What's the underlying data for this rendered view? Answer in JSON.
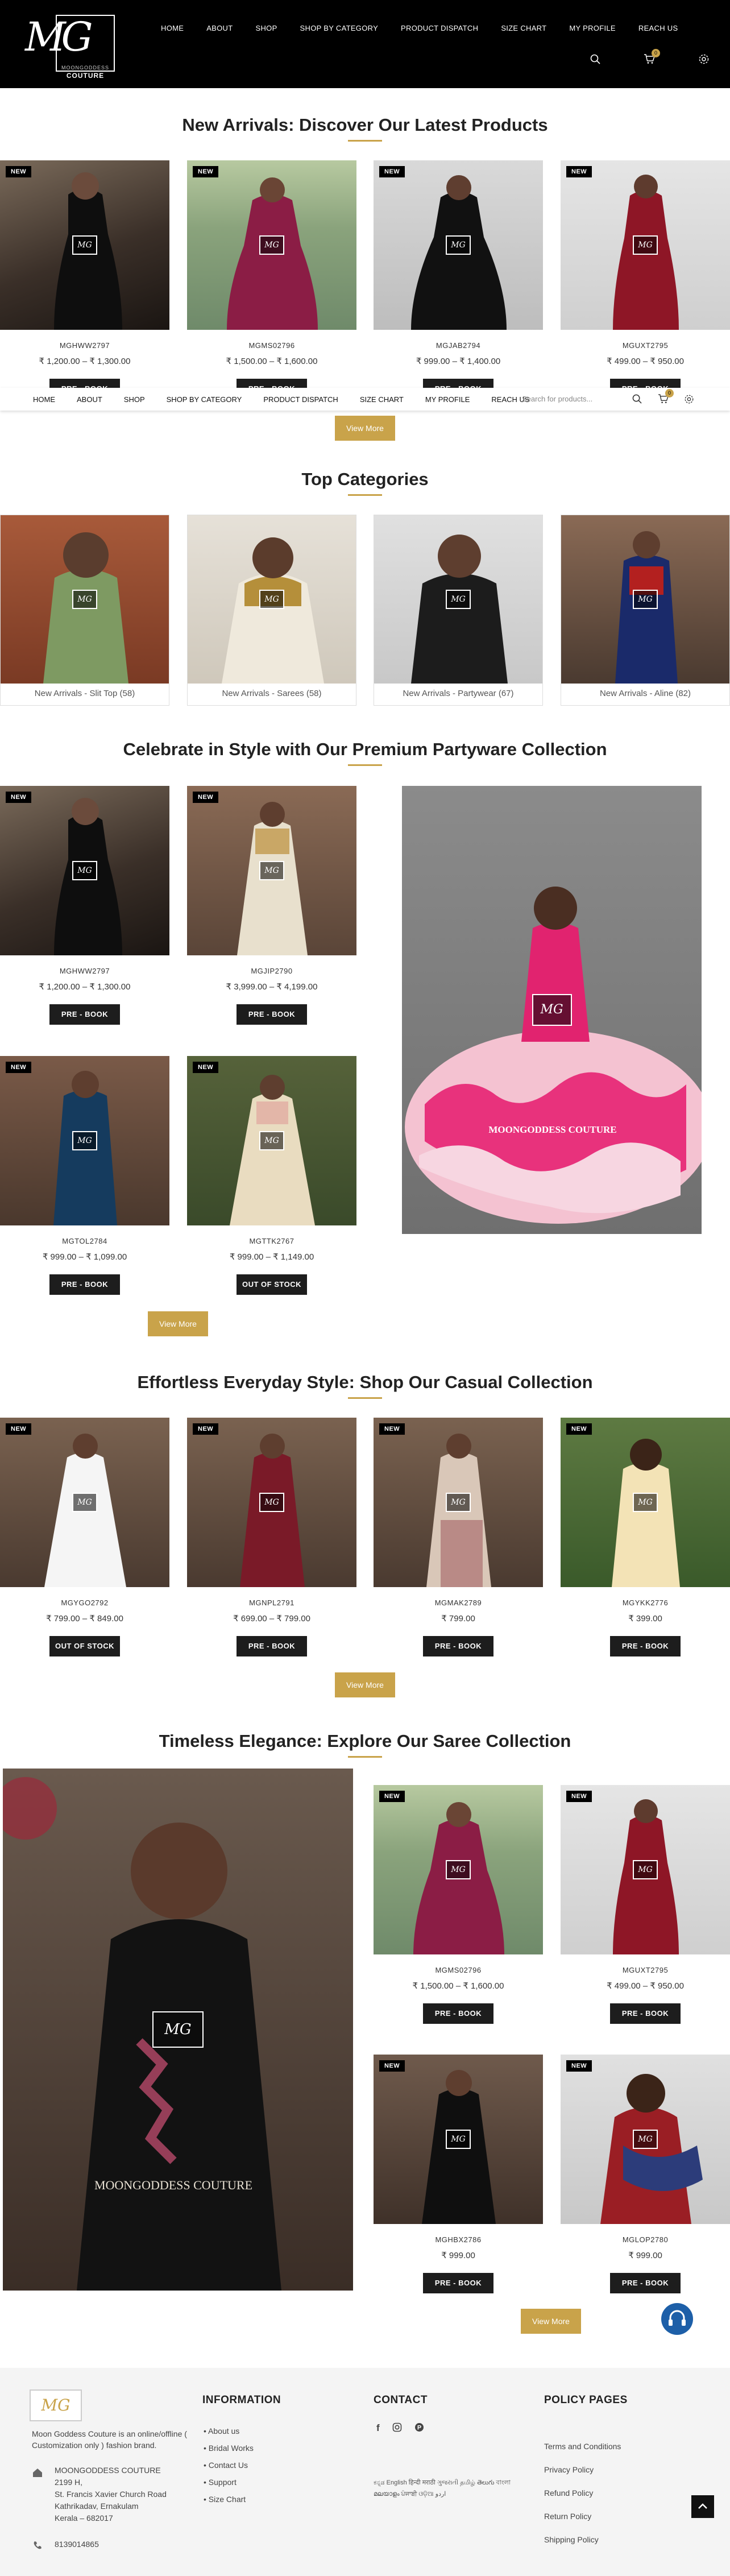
{
  "header": {
    "logo_brand_top": "MOONGODDESS",
    "logo_brand_bottom": "COUTURE",
    "logo_initials": "MG",
    "nav": [
      "HOME",
      "ABOUT",
      "SHOP",
      "SHOP BY CATEGORY",
      "PRODUCT DISPATCH",
      "SIZE CHART",
      "MY PROFILE",
      "REACH US"
    ],
    "cart_count": "0"
  },
  "sticky": {
    "nav": [
      "HOME",
      "ABOUT",
      "SHOP",
      "SHOP BY CATEGORY",
      "PRODUCT DISPATCH",
      "SIZE CHART",
      "MY PROFILE",
      "REACH US"
    ],
    "search_placeholder": "Search for products...",
    "cart_count": "0"
  },
  "new_arrivals": {
    "title": "New Arrivals: Discover Our Latest Products",
    "view_more": "View More",
    "products": [
      {
        "sku": "MGHWW2797",
        "price": "₹ 1,200.00 – ₹ 1,300.00",
        "badge": "NEW",
        "button": "PRE - BOOK"
      },
      {
        "sku": "MGMS02796",
        "price": "₹ 1,500.00 – ₹ 1,600.00",
        "badge": "NEW",
        "button": "PRE - BOOK"
      },
      {
        "sku": "MGJAB2794",
        "price": "₹ 999.00 – ₹ 1,400.00",
        "badge": "NEW",
        "button": "PRE - BOOK"
      },
      {
        "sku": "MGUXT2795",
        "price": "₹ 499.00 – ₹ 950.00",
        "badge": "NEW",
        "button": "PRE - BOOK"
      }
    ]
  },
  "top_categories": {
    "title": "Top Categories",
    "items": [
      {
        "label": "New Arrivals - Slit Top (58)"
      },
      {
        "label": "New Arrivals - Sarees (58)"
      },
      {
        "label": "New Arrivals - Partywear (67)"
      },
      {
        "label": "New Arrivals - Aline (82)"
      }
    ]
  },
  "partyware": {
    "title": "Celebrate in Style with Our Premium Partyware Collection",
    "view_more": "View More",
    "feature_caption": "MOONGODDESS COUTURE",
    "products": [
      {
        "sku": "MGHWW2797",
        "price": "₹ 1,200.00 – ₹ 1,300.00",
        "badge": "NEW",
        "button": "PRE - BOOK"
      },
      {
        "sku": "MGJIP2790",
        "price": "₹ 3,999.00 – ₹ 4,199.00",
        "badge": "NEW",
        "button": "PRE - BOOK"
      },
      {
        "sku": "MGTOL2784",
        "price": "₹ 999.00 – ₹ 1,099.00",
        "badge": "NEW",
        "button": "PRE - BOOK"
      },
      {
        "sku": "MGTTK2767",
        "price": "₹ 999.00 – ₹ 1,149.00",
        "badge": "NEW",
        "button": "OUT OF STOCK"
      }
    ]
  },
  "casual": {
    "title": "Effortless Everyday Style: Shop Our Casual Collection",
    "view_more": "View More",
    "products": [
      {
        "sku": "MGYGO2792",
        "price": "₹ 799.00 – ₹ 849.00",
        "badge": "NEW",
        "button": "OUT OF STOCK"
      },
      {
        "sku": "MGNPL2791",
        "price": "₹ 699.00 – ₹ 799.00",
        "badge": "NEW",
        "button": "PRE - BOOK"
      },
      {
        "sku": "MGMAK2789",
        "price": "₹ 799.00",
        "badge": "NEW",
        "button": "PRE - BOOK"
      },
      {
        "sku": "MGYKK2776",
        "price": "₹ 399.00",
        "badge": "NEW",
        "button": "PRE - BOOK"
      }
    ]
  },
  "sarees": {
    "title": "Timeless Elegance: Explore Our Saree Collection",
    "view_more": "View More",
    "feature_caption": "MOONGODDESS COUTURE",
    "products": [
      {
        "sku": "MGMS02796",
        "price": "₹ 1,500.00 – ₹ 1,600.00",
        "badge": "NEW",
        "button": "PRE - BOOK"
      },
      {
        "sku": "MGUXT2795",
        "price": "₹ 499.00 – ₹ 950.00",
        "badge": "NEW",
        "button": "PRE - BOOK"
      },
      {
        "sku": "MGHBX2786",
        "price": "₹ 999.00",
        "badge": "NEW",
        "button": "PRE - BOOK"
      },
      {
        "sku": "MGLOP2780",
        "price": "₹ 999.00",
        "badge": "NEW",
        "button": "PRE - BOOK"
      }
    ]
  },
  "footer": {
    "about": "Moon Goddess Couture is an online/offline ( Customization only ) fashion brand.",
    "address_lines": [
      "MOONGODDESS COUTURE",
      "2199 H,",
      "St. Francis Xavier Church Road",
      "Kathrikadav, Ernakulam",
      "Kerala – 682017"
    ],
    "phone": "8139014865",
    "information_title": "INFORMATION",
    "information_links": [
      "About us",
      "Bridal Works",
      "Contact Us",
      "Support",
      "Size Chart"
    ],
    "contact_title": "CONTACT",
    "languages": [
      "ಕನ್ನಡ",
      "English",
      "हिन्दी",
      "मराठी",
      "ગુજરાતી",
      "தமிழ்",
      "తెలుగు",
      "বাংলা",
      "മലയാളം",
      "ਪੰਜਾਬੀ",
      "ଓଡ଼ିଆ",
      "اردو"
    ],
    "policy_title": "POLICY PAGES",
    "policy_links": [
      "Terms and Conditions",
      "Privacy Policy",
      "Refund Policy",
      "Return Policy",
      "Shipping Policy"
    ]
  }
}
